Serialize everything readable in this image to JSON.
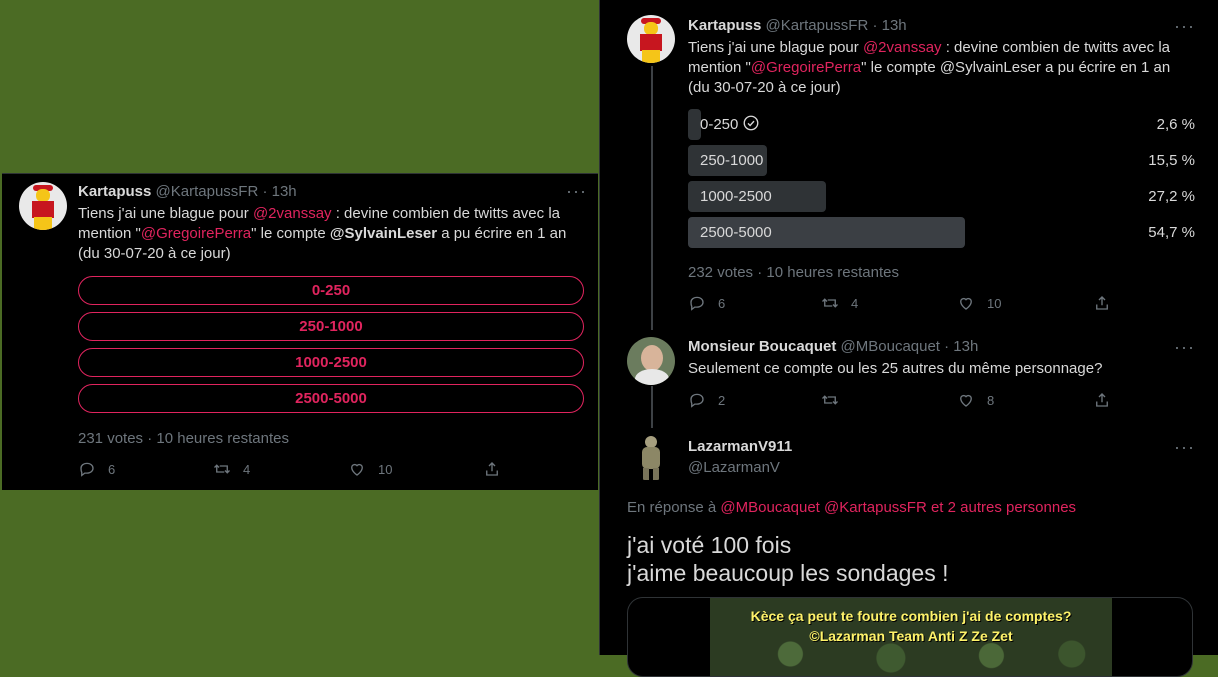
{
  "left_tweet": {
    "name": "Kartapuss",
    "handle_time": "@KartapussFR · 13h",
    "text": {
      "part1": "Tiens j'ai une blague pour ",
      "mention1": "@2vanssay",
      "part2": "  : devine combien de twitts avec la mention \"",
      "mention2": "@GregoirePerra",
      "part3": "\" le compte ",
      "bold": "@SylvainLeser",
      "part4": " a pu écrire en 1 an (du 30-07-20 à ce jour)"
    },
    "options": [
      "0-250",
      "250-1000",
      "1000-2500",
      "2500-5000"
    ],
    "votes": "231 votes · 10 heures restantes",
    "actions": {
      "replies": "6",
      "retweets": "4",
      "likes": "10"
    }
  },
  "right_tweet": {
    "name": "Kartapuss",
    "handle_time": "@KartapussFR · 13h",
    "text": {
      "part1": "Tiens j'ai une blague pour ",
      "mention1": "@2vanssay",
      "part2": "  : devine combien de twitts avec la mention \"",
      "mention2": "@GregoirePerra",
      "part3": "\" le compte @SylvainLeser a pu écrire en 1 an (du 30-07-20 à ce jour)"
    },
    "results": [
      {
        "label": "0-250",
        "pct_text": "2,6 %",
        "pct": 2.6,
        "voted": true
      },
      {
        "label": "250-1000",
        "pct_text": "15,5 %",
        "pct": 15.5,
        "voted": false
      },
      {
        "label": "1000-2500",
        "pct_text": "27,2 %",
        "pct": 27.2,
        "voted": false
      },
      {
        "label": "2500-5000",
        "pct_text": "54,7 %",
        "pct": 54.7,
        "voted": false
      }
    ],
    "votes": "232 votes · 10 heures restantes",
    "actions": {
      "replies": "6",
      "retweets": "4",
      "likes": "10"
    }
  },
  "reply_tweet": {
    "name": "Monsieur Boucaquet",
    "handle_time": "@MBoucaquet · 13h",
    "text": "Seulement ce compte ou les 25 autres du même personnage?",
    "actions": {
      "replies": "2",
      "retweets": "",
      "likes": "8"
    }
  },
  "focus_tweet": {
    "name": "LazarmanV911",
    "handle": "@LazarmanV",
    "reply_prefix": "En réponse à ",
    "reply_mentions": "@MBoucaquet @KartapussFR  et 2 autres personnes",
    "line1": "j'ai voté 100 fois",
    "line2": "j'aime beaucoup les sondages !",
    "media_caption1": "Kèce ça peut te foutre combien j'ai de comptes?",
    "media_caption2": "©Lazarman Team Anti Z  Ze Zet"
  },
  "colors": {
    "accent": "#e0245e",
    "background": "#000000",
    "desktop": "#4b6b24",
    "muted": "#6e767d"
  },
  "icons": [
    "reply-icon",
    "retweet-icon",
    "like-icon",
    "share-icon",
    "more-icon",
    "check-circle-icon"
  ]
}
